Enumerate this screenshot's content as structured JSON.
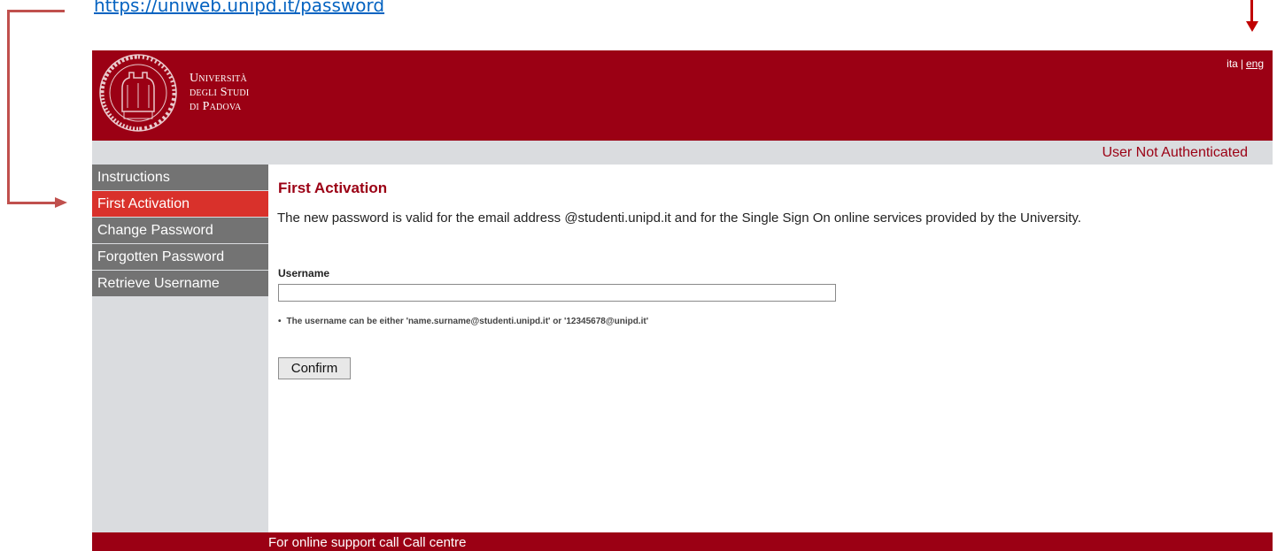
{
  "annotation": {
    "url": "https://uniweb.unipd.it/password"
  },
  "header": {
    "university_line1": "Università",
    "university_line2": "degli Studi",
    "university_line3": "di Padova",
    "lang_ita": "ita",
    "lang_separator": "|",
    "lang_eng": "eng",
    "seal_icon": "university-seal-icon"
  },
  "status": {
    "text": "User Not Authenticated"
  },
  "sidebar": {
    "items": [
      {
        "label": "Instructions",
        "active": false
      },
      {
        "label": "First Activation",
        "active": true
      },
      {
        "label": "Change Password",
        "active": false
      },
      {
        "label": "Forgotten Password",
        "active": false
      },
      {
        "label": "Retrieve Username",
        "active": false
      }
    ]
  },
  "main": {
    "title": "First Activation",
    "description": "The new password is valid for the email address @studenti.unipd.it and for the Single Sign On online services provided by the University.",
    "username_label": "Username",
    "username_value": "",
    "hint_bullet": "•",
    "hint": "The username can be either 'name.surname@studenti.unipd.it' or '12345678@unipd.it'",
    "confirm_label": "Confirm"
  },
  "footer": {
    "text": "For online support call Call centre"
  },
  "colors": {
    "brand_red": "#9b0014",
    "nav_active": "#d9312b",
    "nav_item": "#737373",
    "panel_gray": "#dadcdf",
    "annotation_arrow": "#c0504d",
    "link_blue": "#0563c1"
  }
}
